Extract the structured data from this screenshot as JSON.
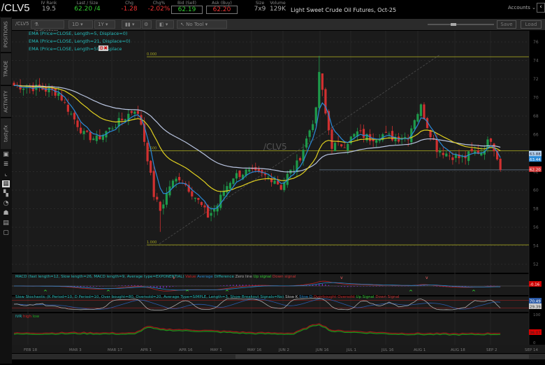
{
  "header": {
    "symbol": "/CLV5",
    "iv_rank_label": "IV Rank",
    "iv_rank": "19.5",
    "last_label": "Last / Size",
    "last": "62.20 /4",
    "chg_label": "Chg",
    "chg": "-1.28",
    "chgp_label": "Chg%",
    "chgp": "-2.02%",
    "bid_label": "Bid (Sell)",
    "bid": "62.19",
    "ask_label": "Ask (Buy)",
    "ask": "62.20",
    "size_label": "Size",
    "size": "7x9",
    "volume_label": "Volume",
    "volume": "129K",
    "description": "Light Sweet Crude Oil Futures, Oct-25",
    "accounts": "Accounts"
  },
  "sidebar": {
    "tabs": [
      "POSITIONS",
      "TRADE",
      "ACTIVITY",
      "tastyfx"
    ]
  },
  "toolbar": {
    "symbol": "/CLV5",
    "indicators": "Indicators",
    "interval": "1D",
    "range": "1Y",
    "tool": "No Tool",
    "save": "Save",
    "load": "Load"
  },
  "studies": {
    "ema5": "EMA (Price=CLOSE, Length=5, Displace=0)",
    "ema21": "EMA (Price=CLOSE, Length=21, Displace=0)",
    "ema50": "EMA (Price=CLOSE, Length=50, Displace",
    "macd": "MACD (fast length=12, Slow length=26, MACD length=9, Average type=EXPONENTIAL)",
    "macd_legend": [
      "Value",
      "Average",
      "Difference",
      "Zero line",
      "Up signal",
      "Down signal"
    ],
    "stoch": "Slow Stochastic (K Period=10, D Period=10, Over bought=80, Oversold=20, Average Type=SIMPLE, Length=3, Show Breakout Signals=No)",
    "stoch_legend": [
      "Slow K",
      "Slow D",
      "Overbought",
      "Oversold",
      "Up Signal",
      "Down Signal"
    ],
    "ivr": "IVR",
    "ivr_legend": [
      "high",
      "low"
    ]
  },
  "watermark": "/CLV5",
  "fib": {
    "f0": "0.000",
    "f50": "0.500",
    "f100": "1.000"
  },
  "badges": {
    "ema_a": "63.88",
    "ema_b": "63.44",
    "last": "62.20",
    "macd": "-0.16",
    "stoch_k": "70.49",
    "stoch_d": "29.39",
    "ivr_top": "100",
    "ivr_val": "36.07",
    "ivr_bot": "0"
  },
  "colors": {
    "up": "#1e9a4a",
    "down": "#d03030",
    "ema5": "#2a8ad8",
    "ema21": "#e0d020",
    "ema50": "#b8c4e0",
    "fib": "#a0a020"
  },
  "chart_data": {
    "type": "candlestick",
    "symbol": "/CLV5",
    "y_ticks": [
      76,
      74,
      72,
      70,
      68,
      66,
      64,
      62,
      60,
      58,
      56,
      54,
      52
    ],
    "ylim": [
      51,
      77
    ],
    "x_ticks": [
      "FEB 18",
      "MAR 3",
      "MAR 17",
      "APR 1",
      "APR 16",
      "MAY 1",
      "MAY 16",
      "JUN 2",
      "JUN 16",
      "JUL 1",
      "JUL 16",
      "AUG 1",
      "AUG 18",
      "SEP 2",
      "SEP 14"
    ],
    "close_keypoints": [
      [
        0,
        71.3
      ],
      [
        8,
        71.0
      ],
      [
        14,
        70.5
      ],
      [
        18,
        68.2
      ],
      [
        22,
        66.0
      ],
      [
        26,
        65.5
      ],
      [
        30,
        66.6
      ],
      [
        34,
        67.6
      ],
      [
        38,
        68.8
      ],
      [
        40,
        67.2
      ],
      [
        42,
        63.5
      ],
      [
        44,
        59.5
      ],
      [
        46,
        57.8
      ],
      [
        49,
        60.5
      ],
      [
        52,
        61.4
      ],
      [
        55,
        60.2
      ],
      [
        58,
        58.8
      ],
      [
        61,
        57.2
      ],
      [
        64,
        58.4
      ],
      [
        66,
        60.0
      ],
      [
        69,
        61.5
      ],
      [
        73,
        62.0
      ],
      [
        78,
        61.6
      ],
      [
        82,
        61.2
      ],
      [
        84,
        60.3
      ],
      [
        86,
        61.6
      ],
      [
        89,
        62.8
      ],
      [
        91,
        64.5
      ],
      [
        93,
        66.5
      ],
      [
        95,
        68.5
      ],
      [
        96,
        72.8
      ],
      [
        97,
        70.5
      ],
      [
        98,
        68.2
      ],
      [
        100,
        64.8
      ],
      [
        104,
        65.0
      ],
      [
        108,
        66.2
      ],
      [
        112,
        65.6
      ],
      [
        116,
        66.0
      ],
      [
        120,
        65.6
      ],
      [
        124,
        65.8
      ],
      [
        126,
        67.8
      ],
      [
        128,
        69.0
      ],
      [
        130,
        67.0
      ],
      [
        133,
        64.5
      ],
      [
        137,
        63.8
      ],
      [
        141,
        63.4
      ],
      [
        144,
        64.0
      ],
      [
        147,
        64.2
      ],
      [
        150,
        65.6
      ],
      [
        152,
        63.6
      ],
      [
        153,
        62.2
      ]
    ],
    "ivr_keypoints": [
      [
        0,
        30
      ],
      [
        20,
        32
      ],
      [
        38,
        30
      ],
      [
        42,
        55
      ],
      [
        46,
        45
      ],
      [
        60,
        40
      ],
      [
        75,
        32
      ],
      [
        88,
        30
      ],
      [
        93,
        55
      ],
      [
        96,
        65
      ],
      [
        100,
        40
      ],
      [
        120,
        30
      ],
      [
        140,
        28
      ],
      [
        153,
        30
      ]
    ]
  }
}
